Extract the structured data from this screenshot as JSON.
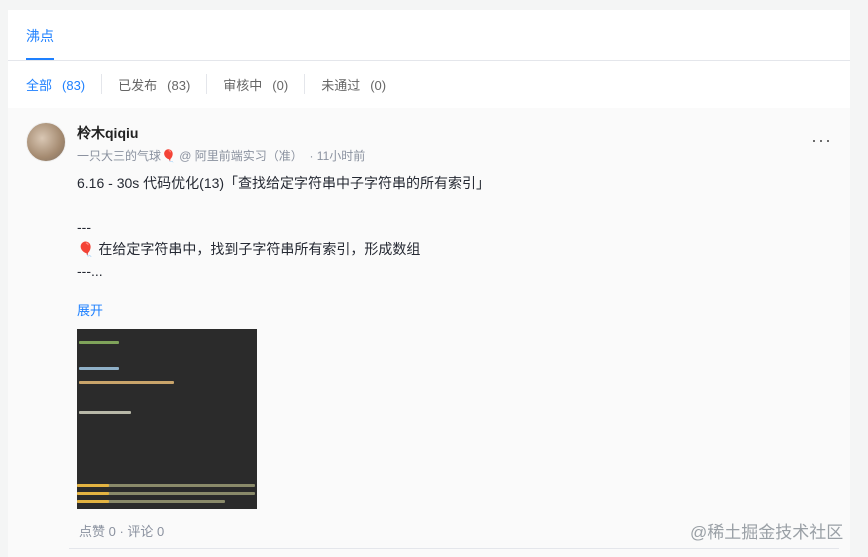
{
  "tab": {
    "label": "沸点"
  },
  "filters": [
    {
      "label": "全部",
      "count": "(83)"
    },
    {
      "label": "已发布",
      "count": "(83)"
    },
    {
      "label": "审核中",
      "count": "(0)"
    },
    {
      "label": "未通过",
      "count": "(0)"
    }
  ],
  "post": {
    "author": "柃木qiqiu",
    "bio": "一只大三的气球🎈 @ 阿里前端实习（准）",
    "time": "· 11小时前",
    "more": "···",
    "line1": "6.16 - 30s 代码优化(13)「查找给定字符串中子字符串的所有索引」",
    "line2": "---",
    "line3": "🎈 在给定字符串中，找到子字符串所有索引，形成数组",
    "line4": "---...",
    "expand": "展开",
    "stats": "点赞 0 · 评论 0"
  },
  "watermark": "@稀土掘金技术社区"
}
